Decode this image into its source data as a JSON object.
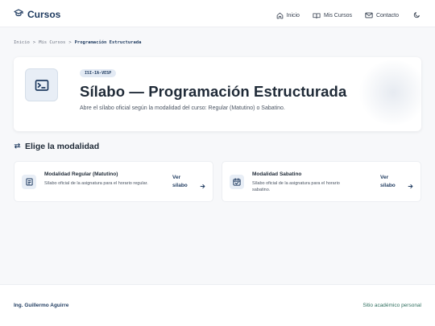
{
  "header": {
    "brand": "Cursos",
    "nav": [
      {
        "label": "Inicio",
        "icon": "home-icon"
      },
      {
        "label": "Mis Cursos",
        "icon": "book-icon"
      },
      {
        "label": "Contacto",
        "icon": "mail-icon"
      }
    ],
    "theme_icon": "moon-icon"
  },
  "breadcrumb": {
    "items": [
      "Inicio",
      "Mis Cursos"
    ],
    "separator": ">",
    "current": "Programación Estructurada"
  },
  "hero": {
    "badge": "ISI-IA-VESP",
    "title": "Sílabo — Programación Estructurada",
    "subtitle": "Abre el sílabo oficial según la modalidad del curso: Regular (Matutino) o Sabatino.",
    "icon": "terminal-icon"
  },
  "section": {
    "title": "Elige la modalidad",
    "icon": "swap-arrows-icon"
  },
  "cards": [
    {
      "title": "Modalidad Regular (Matutino)",
      "description": "Sílabo oficial de la asignatura para el horario regular.",
      "link": "Ver sílabo",
      "icon": "document-icon"
    },
    {
      "title": "Modalidad Sabatino",
      "description": "Sílabo oficial de la asignatura para el horario sabatino.",
      "link": "Ver sílabo",
      "icon": "calendar-check-icon"
    }
  ],
  "footer": {
    "author": "Ing. Guillermo Aguirre",
    "tagline": "Sitio académico personal"
  },
  "colors": {
    "primary": "#1e3a5f",
    "background": "#f7f8fa",
    "icon_bg": "#e8eef6",
    "footer_accent": "#2f6f5f"
  }
}
